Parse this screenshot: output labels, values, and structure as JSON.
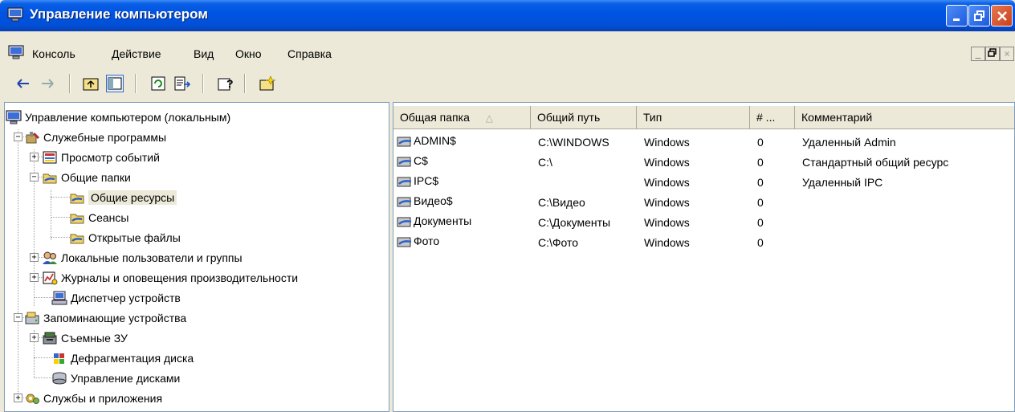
{
  "window": {
    "title": "Управление компьютером"
  },
  "menu": {
    "items": [
      "Консоль",
      "Действие",
      "Вид",
      "Окно",
      "Справка"
    ]
  },
  "toolbar": {
    "icons": [
      "back-icon",
      "forward-icon",
      "up-level-icon",
      "show-tree-icon",
      "refresh-icon",
      "export-list-icon",
      "help-icon",
      "new-share-icon"
    ]
  },
  "tree": {
    "root": "Управление компьютером (локальным)",
    "items": [
      {
        "label": "Служебные программы",
        "expanded": true
      },
      {
        "label": "Просмотр событий",
        "expanded": false
      },
      {
        "label": "Общие папки",
        "expanded": true
      },
      {
        "label": "Общие ресурсы",
        "selected": true
      },
      {
        "label": "Сеансы"
      },
      {
        "label": "Открытые файлы"
      },
      {
        "label": "Локальные пользователи и группы",
        "expanded": false
      },
      {
        "label": "Журналы и оповещения производительности",
        "expanded": false
      },
      {
        "label": "Диспетчер устройств"
      },
      {
        "label": "Запоминающие устройства",
        "expanded": true
      },
      {
        "label": "Съемные ЗУ",
        "expanded": false
      },
      {
        "label": "Дефрагментация диска"
      },
      {
        "label": "Управление дисками"
      },
      {
        "label": "Службы и приложения",
        "expanded": false
      }
    ]
  },
  "list": {
    "columns": [
      "Общая папка",
      "Общий путь",
      "Тип",
      "# ...",
      "Комментарий"
    ],
    "sort_indicator": "△",
    "rows": [
      {
        "name": "ADMIN$",
        "path": "C:\\WINDOWS",
        "type": "Windows",
        "count": "0",
        "comment": "Удаленный Admin"
      },
      {
        "name": "C$",
        "path": "C:\\",
        "type": "Windows",
        "count": "0",
        "comment": "Стандартный общий ресурс"
      },
      {
        "name": "IPC$",
        "path": "",
        "type": "Windows",
        "count": "0",
        "comment": "Удаленный IPC"
      },
      {
        "name": "Видео$",
        "path": "C:\\Видео",
        "type": "Windows",
        "count": "0",
        "comment": ""
      },
      {
        "name": "Документы",
        "path": "C:\\Документы",
        "type": "Windows",
        "count": "0",
        "comment": ""
      },
      {
        "name": "Фото",
        "path": "C:\\Фото",
        "type": "Windows",
        "count": "0",
        "comment": ""
      }
    ]
  },
  "colors": {
    "titlebar": "#0054e3",
    "chrome": "#ece9d8",
    "pane_border": "#7f9db9"
  }
}
